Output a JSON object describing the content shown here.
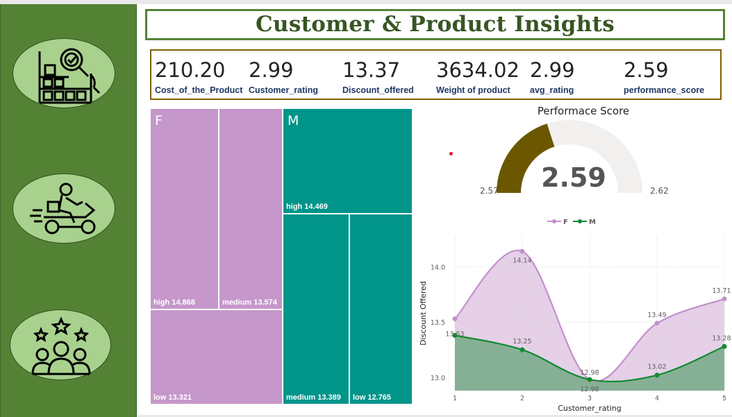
{
  "dashboard": {
    "title": "Customer & Product Insights"
  },
  "sidebar": {
    "items": [
      {
        "icon": "warehouse-inventory-icon"
      },
      {
        "icon": "delivery-scooter-icon"
      },
      {
        "icon": "customer-rating-icon"
      }
    ]
  },
  "kpis": [
    {
      "value": "210.20",
      "label": "Cost_of_the_Product"
    },
    {
      "value": "2.99",
      "label": "Customer_rating"
    },
    {
      "value": "13.37",
      "label": "Discount_offered"
    },
    {
      "value": "3634.02",
      "label": "Weight of product"
    },
    {
      "value": "2.99",
      "label": "avg_rating"
    },
    {
      "value": "2.59",
      "label": "performance_score"
    }
  ],
  "treemap": {
    "groups": [
      {
        "name": "F",
        "color": "#c597cb",
        "cells": [
          {
            "label": "high 14.868",
            "value": 14.868
          },
          {
            "label": "medium 13.574",
            "value": 13.574
          },
          {
            "label": "low 13.321",
            "value": 13.321
          }
        ]
      },
      {
        "name": "M",
        "color": "#01958a",
        "cells": [
          {
            "label": "high 14.469",
            "value": 14.469
          },
          {
            "label": "medium 13.389",
            "value": 13.389
          },
          {
            "label": "low 12.765",
            "value": 12.765
          }
        ]
      }
    ]
  },
  "gauge": {
    "title": "Performace Score",
    "value": "2.59",
    "min": "2.57",
    "max": "2.62",
    "fill_color": "#6b5700",
    "track_color": "#f1f0ee"
  },
  "chart_data": {
    "type": "area",
    "x": [
      1,
      2,
      3,
      4,
      5
    ],
    "xlabel": "Customer_rating",
    "ylabel": "Discount Offered",
    "ylim": [
      12.88,
      14.28
    ],
    "yticks": [
      "13.0",
      "13.5",
      "14.0"
    ],
    "grid": true,
    "legend_position": "top",
    "series": [
      {
        "name": "F",
        "color": "#c38fcd",
        "values": [
          13.53,
          14.14,
          12.98,
          13.49,
          13.71
        ]
      },
      {
        "name": "M",
        "color": "#118a30",
        "values": [
          13.38,
          13.25,
          12.98,
          13.02,
          13.28
        ]
      }
    ],
    "data_labels": [
      {
        "series": "F",
        "labels": [
          "13.53",
          "14.14",
          "12.98",
          "13.49",
          "13.71"
        ]
      },
      {
        "series": "M",
        "labels": [
          "",
          "13.25",
          "12.98",
          "13.02",
          "13.28"
        ]
      }
    ]
  }
}
